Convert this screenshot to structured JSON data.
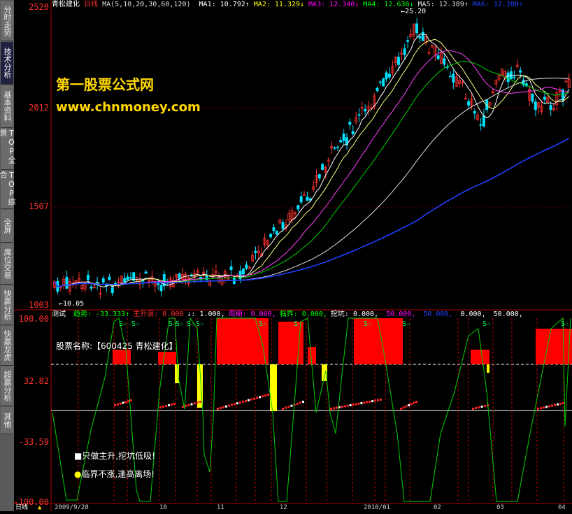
{
  "sidebar": {
    "tabs": [
      {
        "label": "分时走势",
        "active": false
      },
      {
        "label": "技术分析",
        "active": true
      },
      {
        "label": "基本资料",
        "active": false
      },
      {
        "label": "TOP全景",
        "active": false
      },
      {
        "label": "TOP综合",
        "active": false
      },
      {
        "label": "全屏",
        "active": false
      },
      {
        "label": "席位交易",
        "active": false
      },
      {
        "label": "快赢分析",
        "active": false
      },
      {
        "label": "快赢龙虎",
        "active": false
      },
      {
        "label": "超赢分析",
        "active": false
      },
      {
        "label": "其他",
        "active": false
      }
    ]
  },
  "price_panel": {
    "axis_labels": [
      "2520",
      "2012",
      "1507",
      "1003"
    ],
    "stock_name": "青松建化",
    "period": "日线",
    "ma_params": "MA(5,10,20,30,60,120)",
    "ma_values": [
      {
        "label": "MA1: 10.792",
        "arrow": "↑",
        "color": "#ffffff"
      },
      {
        "label": "MA2: 11.329",
        "arrow": "↓",
        "color": "#ffff00"
      },
      {
        "label": "MA3: 12.340",
        "arrow": "↓",
        "color": "#ff00ff"
      },
      {
        "label": "MA4: 12.636",
        "arrow": "↓",
        "color": "#00ff00"
      },
      {
        "label": "MA5: 12.389",
        "arrow": "↑",
        "color": "#dddddd"
      },
      {
        "label": "MA6: 12.200",
        "arrow": "↑",
        "color": "#2040ff"
      }
    ],
    "high_label": "25.20",
    "low_label": "10.05",
    "watermark_title": "第一股票公式网",
    "watermark_url": "www.chnmoney.com"
  },
  "indicator_panel": {
    "name": "测试",
    "items": [
      {
        "label": "趋势:",
        "value": "-33.333",
        "arrow": "↑",
        "color": "#00ff00"
      },
      {
        "label": "主升浪:",
        "value": "0.000",
        "arrow": "",
        "color": "#ff3030"
      },
      {
        "label": "↓:",
        "value": "1.000,",
        "arrow": "",
        "color": "#ffffff"
      },
      {
        "label": "周期:",
        "value": "0.000,",
        "arrow": "",
        "color": "#ff00ff"
      },
      {
        "label": "临界:",
        "value": "0.000,",
        "arrow": "",
        "color": "#00ff00"
      },
      {
        "label": "挖坑:",
        "value": "0.000,",
        "arrow": "",
        "color": "#ffffff"
      },
      {
        "label": "",
        "value": "50.000,",
        "arrow": "",
        "color": "#ff00ff"
      },
      {
        "label": "",
        "value": "50.000,",
        "arrow": "",
        "color": "#2040ff"
      },
      {
        "label": "",
        "value": "0.000,",
        "arrow": "",
        "color": "#ffffff"
      },
      {
        "label": "",
        "value": "50.000,",
        "arrow": "",
        "color": "#ffffff"
      }
    ],
    "axis_labels": [
      "100.00",
      "32.82",
      "-33.59",
      "-100.00"
    ],
    "stock_label": "股票名称:【600425 青松建化】",
    "legend_1": "只做主升,挖坑低吸!",
    "legend_2": "临界不涨,逢高离场!",
    "signal_label": "S☆"
  },
  "footer": {
    "period_label": "日线",
    "date_labels": [
      "2009/9/28",
      "10",
      "11",
      "12",
      "2010/01",
      "02",
      "03",
      "04"
    ]
  },
  "colors": {
    "up": "#ff3030",
    "down": "#00e0ff",
    "axis": "#b00000",
    "main_rise": "#ff0000",
    "critical": "#ffff00",
    "trend": "#00d000"
  }
}
